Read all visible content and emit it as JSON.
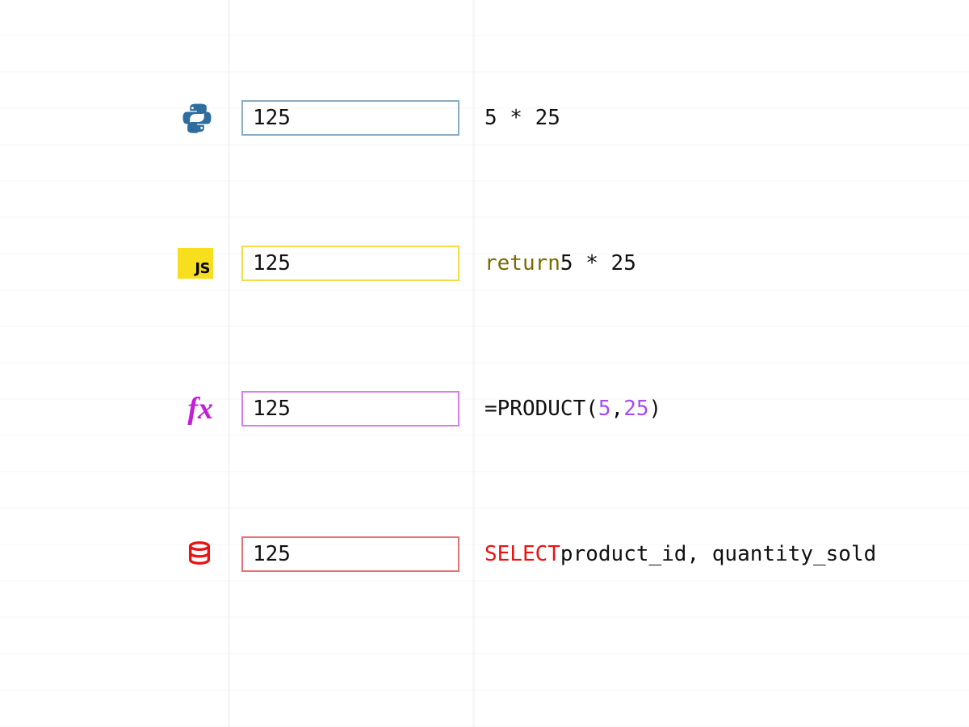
{
  "rows": {
    "python": {
      "icon": "python-icon",
      "value": "125",
      "code_plain": "5 * 25"
    },
    "js": {
      "icon": "javascript-icon",
      "badge_text": "JS",
      "value": "125",
      "code_keyword": "return",
      "code_rest": " 5 * 25"
    },
    "fx": {
      "icon": "formula-icon",
      "label": "fx",
      "value": "125",
      "code_prefix": "=PRODUCT(",
      "code_num1": "5",
      "code_sep": ",",
      "code_num2": "25",
      "code_suffix": ")"
    },
    "sql": {
      "icon": "database-icon",
      "value": "125",
      "code_keyword": "SELECT",
      "code_rest": " product_id, quantity_sold"
    }
  }
}
